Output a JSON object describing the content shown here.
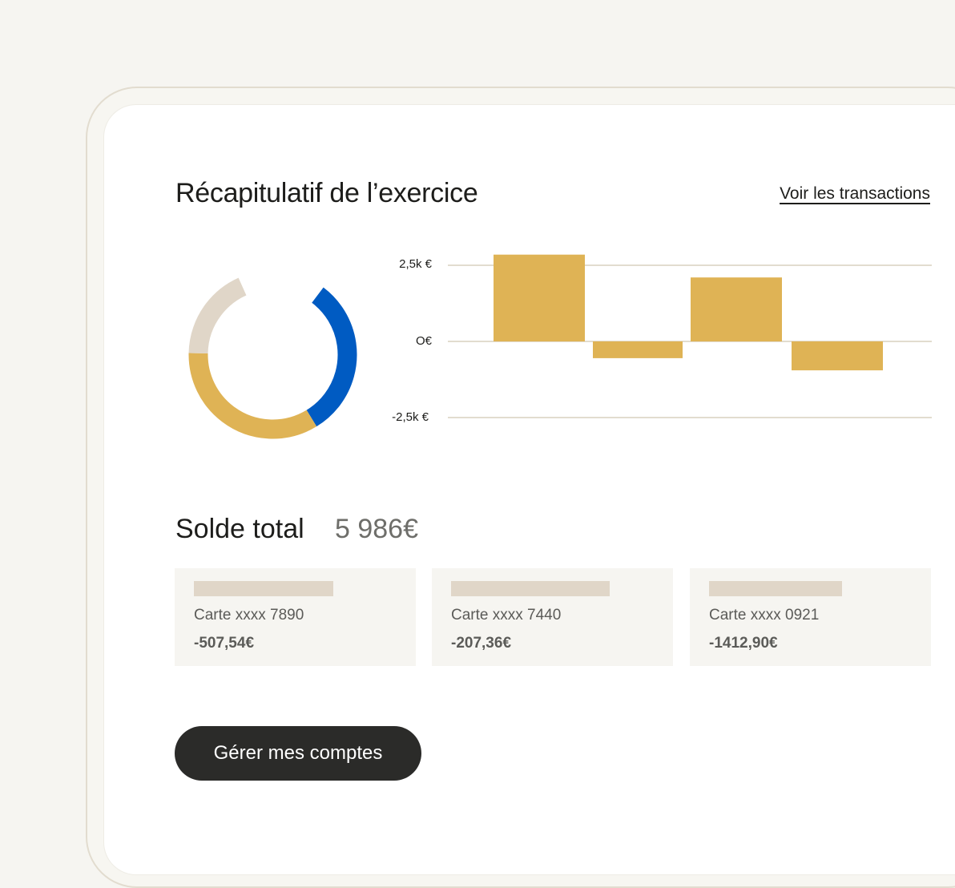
{
  "summary": {
    "title": "Récapitulatif de l’exercice",
    "transactions_link": "Voir les transactions"
  },
  "colors": {
    "blue": "#005bc2",
    "gold": "#dfb355",
    "beige": "#e0d6c8",
    "axis": "#e2dccf",
    "button": "#2b2b29"
  },
  "chart_data": [
    {
      "type": "pie",
      "style": "donut",
      "slices": [
        {
          "value": 0.31,
          "color": "#005bc2"
        },
        {
          "value": 0.34,
          "color": "#dfb355"
        },
        {
          "value": 0.18,
          "color": "#e0d6c8"
        }
      ],
      "gap_fraction": 0.17
    },
    {
      "type": "bar",
      "categories": [
        "",
        "",
        "",
        ""
      ],
      "values": [
        2850,
        -550,
        2100,
        -950
      ],
      "ylim": [
        -2500,
        2500
      ],
      "yticks": [
        2500,
        0,
        -2500
      ],
      "ytick_labels": [
        "2,5k €",
        "O€",
        "-2,5k €"
      ],
      "grid": true,
      "color": "#dfb355"
    }
  ],
  "balance": {
    "label": "Solde total",
    "value": "5 986€"
  },
  "cards": [
    {
      "name": "Carte xxxx 7890",
      "amount": "-507,54€"
    },
    {
      "name": "Carte xxxx 7440",
      "amount": "-207,36€"
    },
    {
      "name": "Carte xxxx 0921",
      "amount": "-1412,90€"
    }
  ],
  "actions": {
    "manage_accounts": "Gérer mes comptes"
  }
}
